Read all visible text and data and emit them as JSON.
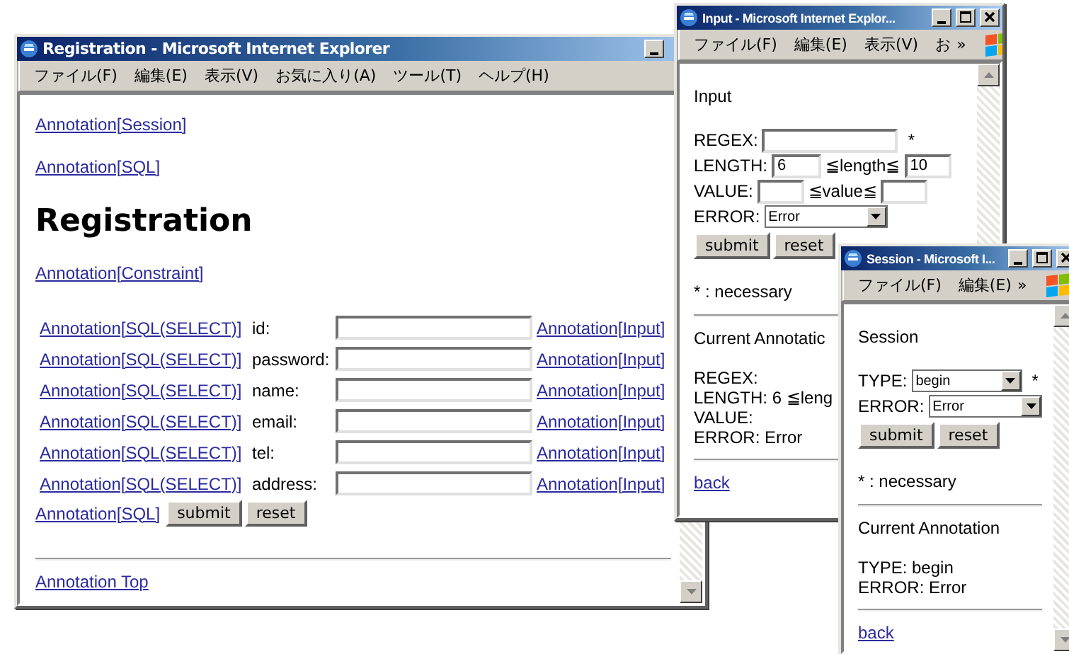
{
  "registration_window": {
    "title": "Registration - Microsoft Internet Explorer",
    "menu": [
      "ファイル(F)",
      "編集(E)",
      "表示(V)",
      "お気に入り(A)",
      "ツール(T)",
      "ヘルプ(H)"
    ],
    "top_links": [
      "Annotation[Session]",
      "Annotation[SQL]"
    ],
    "heading": "Registration",
    "constraint_link": "Annotation[Constraint]",
    "fields": [
      {
        "sql_link": "Annotation[SQL(SELECT)]",
        "label": "id:",
        "input_link": "Annotation[Input]"
      },
      {
        "sql_link": "Annotation[SQL(SELECT)]",
        "label": "password:",
        "input_link": "Annotation[Input]"
      },
      {
        "sql_link": "Annotation[SQL(SELECT)]",
        "label": "name:",
        "input_link": "Annotation[Input]"
      },
      {
        "sql_link": "Annotation[SQL(SELECT)]",
        "label": "email:",
        "input_link": "Annotation[Input]"
      },
      {
        "sql_link": "Annotation[SQL(SELECT)]",
        "label": "tel:",
        "input_link": "Annotation[Input]"
      },
      {
        "sql_link": "Annotation[SQL(SELECT)]",
        "label": "address:",
        "input_link": "Annotation[Input]"
      }
    ],
    "form_link": "Annotation[SQL]",
    "buttons": [
      "submit",
      "reset"
    ],
    "footer_link": "Annotation Top"
  },
  "input_window": {
    "title": "Input - Microsoft Internet Explor...",
    "menu": [
      "ファイル(F)",
      "編集(E)",
      "表示(V)",
      "お"
    ],
    "more": "»",
    "heading": "Input",
    "rows": [
      {
        "kind": "text",
        "label": "REGEX:",
        "required": "*"
      },
      {
        "kind": "range",
        "label": "LENGTH:",
        "min": "6",
        "op": "≦length≦",
        "max": "10"
      },
      {
        "kind": "range",
        "label": "VALUE:",
        "op": "≦value≦"
      },
      {
        "kind": "select",
        "label": "ERROR:",
        "value": "Error"
      }
    ],
    "buttons": [
      "submit",
      "reset"
    ],
    "note": "* : necessary",
    "current_title": "Current Annotatic",
    "current_lines": [
      "REGEX:",
      "LENGTH: 6 ≦leng",
      "VALUE:",
      "ERROR: Error"
    ],
    "back": "back"
  },
  "session_window": {
    "title": "Session - Microsoft I...",
    "menu": [
      "ファイル(F)",
      "編集(E)"
    ],
    "more": "»",
    "heading": "Session",
    "rows": [
      {
        "kind": "select",
        "label": "TYPE:",
        "value": "begin",
        "required": "*"
      },
      {
        "kind": "select",
        "label": "ERROR:",
        "value": "Error"
      }
    ],
    "buttons": [
      "submit",
      "reset"
    ],
    "note": "* : necessary",
    "current_title": "Current Annotation",
    "current_lines": [
      "TYPE: begin",
      "ERROR: Error"
    ],
    "back": "back"
  }
}
